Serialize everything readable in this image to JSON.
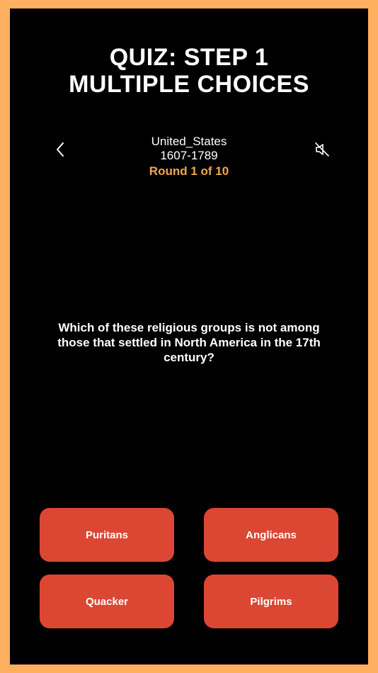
{
  "promo": {
    "line1": "QUIZ: STEP 1",
    "line2": "MULTIPLE CHOICES"
  },
  "header": {
    "subject": "United_States",
    "period": "1607-1789",
    "round": "Round 1 of 10",
    "back_icon": "chevron-left-icon",
    "mute_icon": "speaker-muted-icon"
  },
  "question": {
    "text": "Which of these religious groups is not among those that settled in North America in the 17th century?"
  },
  "answers": [
    {
      "label": "Puritans"
    },
    {
      "label": "Anglicans"
    },
    {
      "label": "Quacker"
    },
    {
      "label": "Pilgrims"
    }
  ],
  "colors": {
    "frame": "#FFAF5F",
    "background": "#000000",
    "accent": "#F0A850",
    "button": "#DB4733"
  }
}
